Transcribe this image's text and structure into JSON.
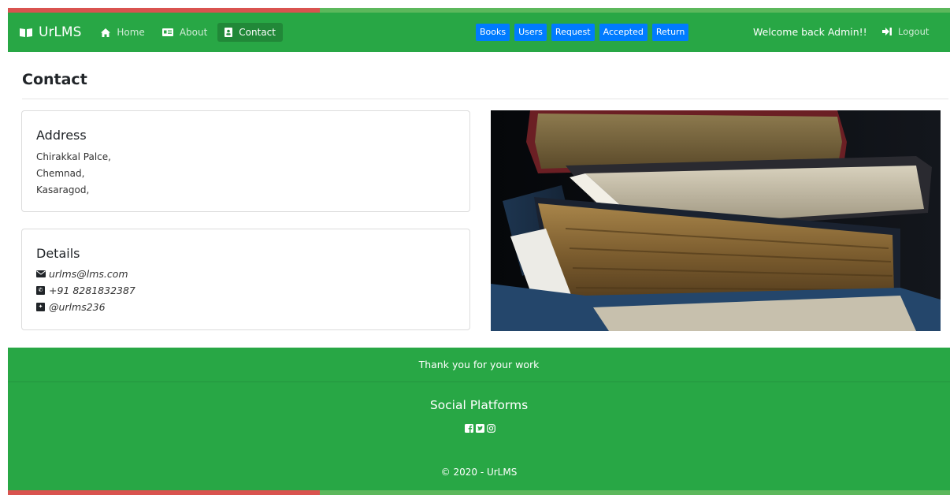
{
  "navbar": {
    "brand": "UrLMS",
    "links": [
      {
        "label": "Home",
        "icon": "home-icon"
      },
      {
        "label": "About",
        "icon": "id-card-icon"
      },
      {
        "label": "Contact",
        "icon": "contact-book-icon"
      }
    ],
    "buttons": [
      "Books",
      "Users",
      "Request",
      "Accepted",
      "Return"
    ],
    "welcome": "Welcome back Admin!!",
    "logout": "Logout"
  },
  "page": {
    "title": "Contact"
  },
  "address": {
    "heading": "Address",
    "lines": [
      "Chirakkal Palce,",
      "Chemnad,",
      "Kasaragod,"
    ]
  },
  "details": {
    "heading": "Details",
    "email": "urlms@lms.com",
    "phone": "+91 8281832387",
    "twitter": "@urlms236"
  },
  "footer": {
    "thanks": "Thank you for your work",
    "social_heading": "Social Platforms",
    "social_icons": [
      "facebook-icon",
      "twitter-icon",
      "instagram-icon"
    ],
    "copyright": "© 2020 - UrLMS"
  },
  "colors": {
    "navbar_green": "#28a745",
    "button_blue": "#007bff",
    "accent_red": "#d9534f",
    "accent_green": "#5cb85c"
  }
}
